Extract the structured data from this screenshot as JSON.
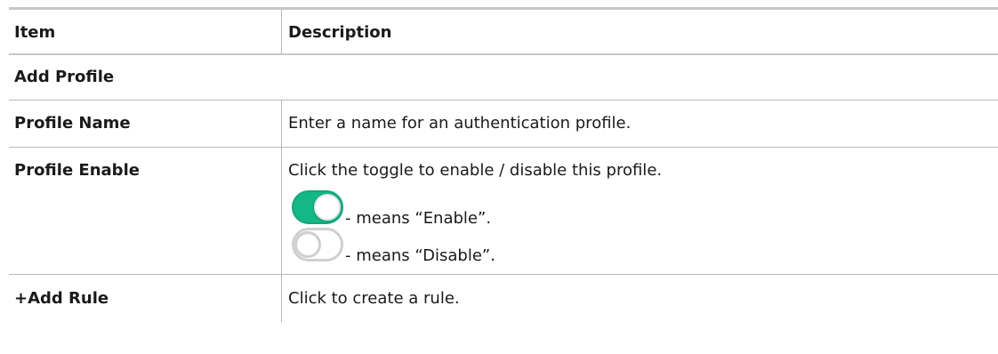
{
  "table": {
    "header": {
      "item": "Item",
      "description": "Description"
    },
    "section_title": "Add Profile",
    "rows": [
      {
        "item": "Profile Name",
        "description": "Enter a name for an authentication profile."
      },
      {
        "item": "Profile Enable",
        "description": "Click the toggle to enable / disable this profile.",
        "toggle_enable_text": "- means “Enable”.",
        "toggle_disable_text": "- means “Disable”."
      },
      {
        "item": "+Add Rule",
        "description": "Click to create a rule."
      }
    ]
  },
  "colors": {
    "toggle_on": "#14b886",
    "toggle_off_border": "#cfcfcf",
    "rule_gray": "#b7b7b7"
  },
  "icons": {
    "toggle_on": "toggle-on-icon",
    "toggle_off": "toggle-off-icon"
  }
}
